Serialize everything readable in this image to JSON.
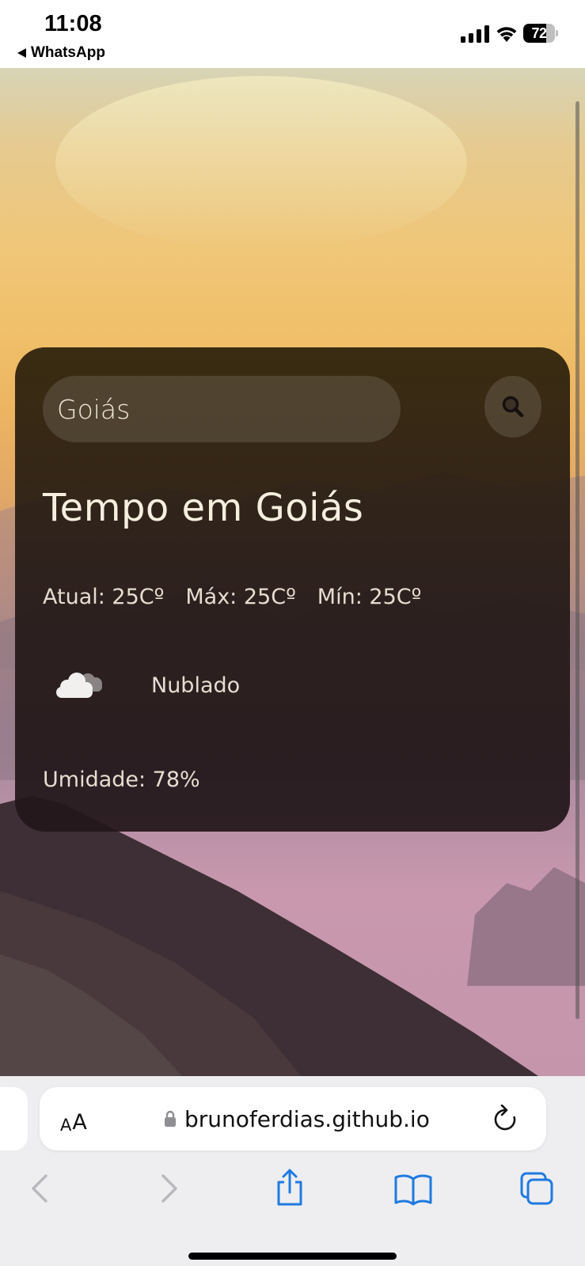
{
  "status_bar": {
    "time": "11:08",
    "back_app": "WhatsApp",
    "battery_percent": "72",
    "battery_level": 0.72
  },
  "weather": {
    "search": {
      "value": "Goiás"
    },
    "title": "Tempo em Goiás",
    "temps": {
      "current": "Atual: 25Cº",
      "max": "Máx: 25Cº",
      "min": "Mín: 25Cº"
    },
    "condition": {
      "icon": "cloud-icon",
      "text": "Nublado"
    },
    "humidity": "Umidade: 78%"
  },
  "safari": {
    "aa_small": "A",
    "aa_large": "A",
    "url": "brunoferdias.github.io",
    "accent_color": "#1f7ae0",
    "toolbar_icons": [
      "back-icon",
      "forward-icon",
      "share-icon",
      "bookmarks-icon",
      "tabs-icon"
    ]
  },
  "colors": {
    "card_bg": "#2a1f14",
    "card_text": "#f6eedf",
    "sky_top": "#d7d4b6",
    "sky_mid": "#f0c06a",
    "sky_bottom": "#c495ab"
  }
}
